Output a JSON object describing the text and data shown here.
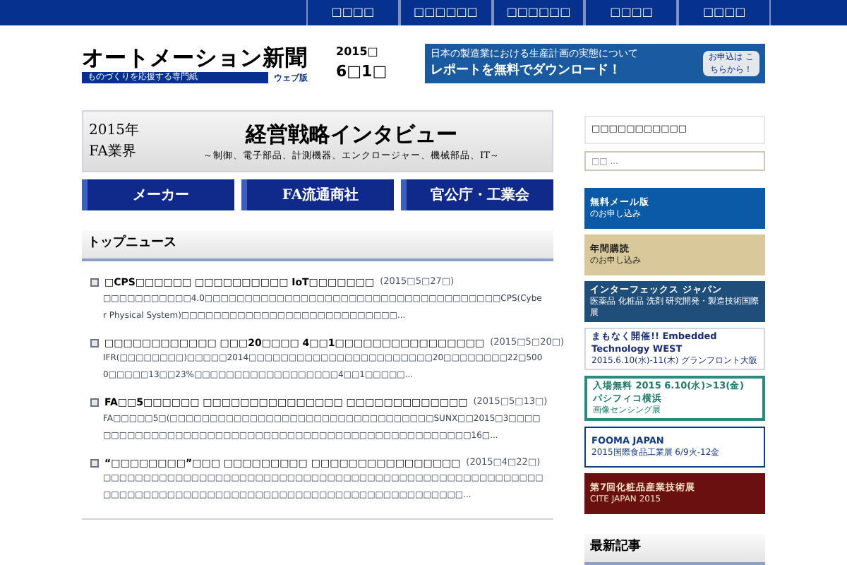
{
  "nav": [
    "□□□□",
    "□□□□□□",
    "□□□□□□",
    "□□□□",
    "□□□□"
  ],
  "logo": {
    "title": "オートメーション新聞",
    "tagline": "ものづくりを応援する専門紙",
    "edition": "ウェブ版"
  },
  "date": {
    "year": "2015□",
    "day": "6□1□"
  },
  "ad_banner": {
    "line_1": "日本の製造業における生産計画の実態について",
    "line_2": "レポートを**無料**でダウンロード！",
    "button": "お申込は こちらから！"
  },
  "interview_banner": {
    "year": "2015年",
    "industry": "FA業界",
    "title": "経営戦略インタビュー",
    "subtitle": "～制御、電子部品、計測機器、エンクロージャー、機械部品、IT～"
  },
  "categories": [
    "メーカー",
    "FA流通商社",
    "官公庁・工業会"
  ],
  "top_news": {
    "heading": "トップニュース",
    "items": [
      {
        "title": "□CPS□□□□□□ □□□□□□□□□□ IoT□□□□□□□",
        "date": "(2015□5□27□)",
        "excerpt": "□□□□□□□□□□□4.0□□□□□□□□□□□□□□□□□□□□□□□□□□□□□□□□□□□□□CPS(Cyber Physical System)□□□□□□□□□□□□□□□□□□□□□□□□□□□..."
      },
      {
        "title": "□□□□□□□□□□□□ □□□20□□□□ 4□□1□□□□□□□□□□□□□□□□",
        "date": "(2015□5□20□)",
        "excerpt": "IFR(□□□□□□□□)□□□□□2014□□□□□□□□□□□□□□□□□□□□□□□20□□□□□□□□22□5000□□□□□13□□23%□□□□□□□□□□□□□□□□□□4□□1□□□□□..."
      },
      {
        "title": "FA□□5□□□□□□ □□□□□□□□□□□□□□□ □□□□□□□□□□□□□",
        "date": "(2015□5□13□)",
        "excerpt": "FA□□□□□5□(□□□□□□□□□□□□□□□□□□□□□□□□□□□□□□□□□SUNX□□2015□3□□□□□□□□□□□□□□□□□□□□□□□□□□□□□□□□□□□□□□□□□□□□□□□□□□16□..."
      },
      {
        "title": "“□□□□□□□□”□□□ □□□□□□□□□ □□□□□□□□□□□□□□□□",
        "date": "(2015□4□22□)",
        "excerpt": "□□□□□□□□□□□□□□□□□□□□□□□□□□□□□□□□□□□□□□□□□□□□□□□□□□□□□□□□□□□□□□□□□□□□□□□□□□□□□□□□□□□□□□□□□□□□□□□□□□□□..."
      }
    ]
  },
  "sidebar": {
    "widget_title": "□□□□□□□□□□□",
    "search": {
      "placeholder": "□□ ..."
    },
    "banners": [
      {
        "kind": "mail",
        "line_1": "**無料**メール版",
        "line_2": "のお申し込み"
      },
      {
        "kind": "subscribe",
        "line_1": "年間購読",
        "line_2": "のお申し込み"
      },
      {
        "kind": "interphex",
        "line_1": "インターフェックス ジャパン",
        "line_2": "医薬品 化粧品 洗剤 研究開発・製造技術国際展"
      },
      {
        "kind": "embedded",
        "line_1": "まもなく開催!! Embedded Technology WEST",
        "line_2": "2015.6.10(水)-11(木) グランフロント大阪"
      },
      {
        "kind": "sensing",
        "line_1": "入場無料 2015 6.10(水)>13(金) パシフィコ横浜",
        "line_2": "画像センシング展"
      },
      {
        "kind": "fooma",
        "line_1": "FOOMA JAPAN",
        "line_2": "2015国際食品工業展 6/9火-12金"
      },
      {
        "kind": "cite",
        "line_1": "第7回化粧品産業技術展",
        "line_2": "CITE JAPAN 2015"
      }
    ],
    "latest_heading": "最新記事"
  }
}
